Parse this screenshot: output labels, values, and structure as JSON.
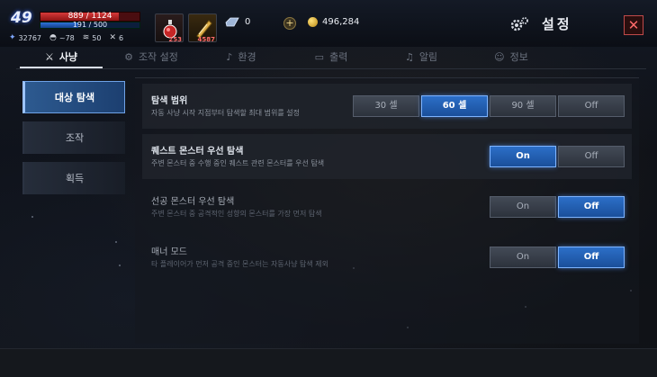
{
  "player": {
    "level": "49",
    "hp_text": "889 / 1124",
    "hp_ratio": 0.79,
    "mp_text": "191 / 500",
    "mp_ratio": 0.38,
    "stats": [
      {
        "icon": "power-icon",
        "value": "32767"
      },
      {
        "icon": "helmet-icon",
        "value": "~78"
      },
      {
        "icon": "wing-icon",
        "value": "50"
      },
      {
        "icon": "sword-icon",
        "value": "6"
      }
    ]
  },
  "items": [
    {
      "icon": "red-potion-icon",
      "qty": "253"
    },
    {
      "icon": "scroll-icon",
      "qty": "4587"
    }
  ],
  "currency": {
    "crystal": "0",
    "gold": "496,284"
  },
  "header": {
    "title": "설정"
  },
  "tabs": [
    {
      "label": "사냥",
      "icon": "crossed-swords-icon",
      "active": true
    },
    {
      "label": "조작 설정",
      "icon": "gear-icon",
      "active": false
    },
    {
      "label": "환경",
      "icon": "music-note-icon",
      "active": false
    },
    {
      "label": "출력",
      "icon": "display-icon",
      "active": false
    },
    {
      "label": "알림",
      "icon": "bell-icon",
      "active": false
    },
    {
      "label": "정보",
      "icon": "user-icon",
      "active": false
    }
  ],
  "sidebar": {
    "items": [
      {
        "label": "대상 탐색",
        "active": true
      },
      {
        "label": "조작",
        "active": false
      },
      {
        "label": "획득",
        "active": false
      }
    ]
  },
  "settings": [
    {
      "title": "탐색 범위",
      "desc": "자동 사냥 시작 지점부터 탐색할 최대 범위를 설정",
      "options": [
        "30 셀",
        "60 셀",
        "90 셀",
        "Off"
      ],
      "selected": 1
    },
    {
      "title": "퀘스트 몬스터 우선 탐색",
      "desc": "주변 몬스터 중 수행 중인 퀘스트 관련 몬스터를 우선 탐색",
      "options": [
        "On",
        "Off"
      ],
      "selected": 0
    },
    {
      "title": "선공 몬스터 우선 탐색",
      "desc": "주변 몬스터 중 공격적인 성향의 몬스터를 가장 먼저 탐색",
      "options": [
        "On",
        "Off"
      ],
      "selected": 1
    },
    {
      "title": "매너 모드",
      "desc": "타 플레이어가 먼저 공격 중인 몬스터는 자동사냥 탐색 제외",
      "options": [
        "On",
        "Off"
      ],
      "selected": 1
    }
  ],
  "colors": {
    "accent": "#2c6fc8",
    "hp": "#d73a3a",
    "mp": "#2f73d8",
    "close": "#ff6a6a"
  }
}
